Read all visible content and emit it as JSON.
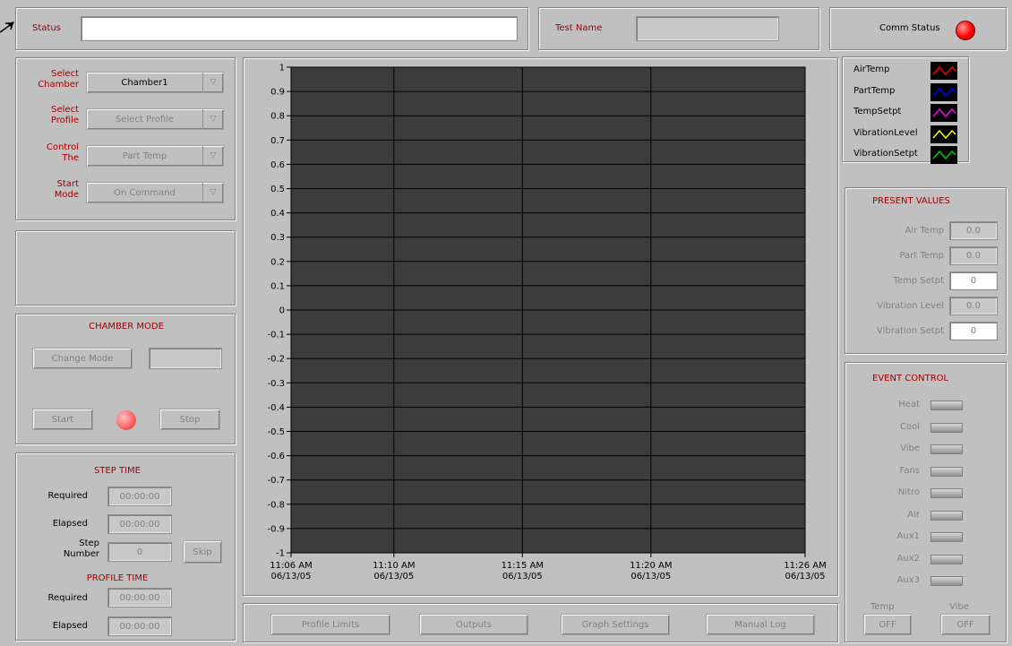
{
  "header": {
    "status_label": "Status",
    "status_value": "",
    "test_name_label": "Test Name",
    "test_name_value": "",
    "comm_status_label": "Comm Status",
    "comm_status_color": "#ff0000"
  },
  "selection": {
    "chamber_label_1": "Select",
    "chamber_label_2": "Chamber",
    "chamber_value": "Chamber1",
    "profile_label_1": "Select",
    "profile_label_2": "Profile",
    "profile_value": "Select Profile",
    "control_label_1": "Control",
    "control_label_2": "The",
    "control_value": "Part Temp",
    "start_label_1": "Start",
    "start_label_2": "Mode",
    "start_value": "On Command"
  },
  "chamber_mode": {
    "title": "CHAMBER MODE",
    "change_mode_label": "Change Mode",
    "mode_value": "",
    "start_label": "Start",
    "stop_label": "Stop",
    "indicator_color": "#ff6060"
  },
  "step_time": {
    "title": "STEP TIME",
    "required_label": "Required",
    "required_value": "00:00:00",
    "elapsed_label": "Elapsed",
    "elapsed_value": "00:00:00",
    "step_label_1": "Step",
    "step_label_2": "Number",
    "step_value": "0",
    "skip_label": "Skip"
  },
  "profile_time": {
    "title": "PROFILE TIME",
    "required_label": "Required",
    "required_value": "00:00:00",
    "elapsed_label": "Elapsed",
    "elapsed_value": "00:00:00"
  },
  "bottom_buttons": {
    "profile_limits": "Profile Limits",
    "outputs": "Outputs",
    "graph_settings": "Graph Settings",
    "manual_log": "Manual Log"
  },
  "legend": [
    {
      "name": "AirTemp",
      "color": "#ff0000"
    },
    {
      "name": "PartTemp",
      "color": "#0000ff"
    },
    {
      "name": "TempSetpt",
      "color": "#ff00ff"
    },
    {
      "name": "VibrationLevel",
      "color": "#ffff00"
    },
    {
      "name": "VibrationSetpt",
      "color": "#00cc00"
    }
  ],
  "present_values": {
    "title": "PRESENT VALUES",
    "air_temp_label": "Air Temp",
    "air_temp_value": "0.0",
    "part_temp_label": "Part Temp",
    "part_temp_value": "0.0",
    "temp_setpt_label": "Temp Setpt",
    "temp_setpt_value": "0",
    "vibration_level_label": "Vibration Level",
    "vibration_level_value": "0.0",
    "vibration_setpt_label": "Vibration Setpt",
    "vibration_setpt_value": "0"
  },
  "event_control": {
    "title": "EVENT CONTROL",
    "items": [
      "Heat",
      "Cool",
      "Vibe",
      "Fans",
      "Nitro",
      "Air",
      "Aux1",
      "Aux2",
      "Aux3"
    ],
    "temp_label": "Temp",
    "temp_value": "OFF",
    "vibe_label": "Vibe",
    "vibe_value": "OFF"
  },
  "chart_data": {
    "type": "line",
    "y_ticks": [
      "1",
      "0.9",
      "0.8",
      "0.7",
      "0.6",
      "0.5",
      "0.4",
      "0.3",
      "0.2",
      "0.1",
      "0",
      "-0.1",
      "-0.2",
      "-0.3",
      "-0.4",
      "-0.5",
      "-0.6",
      "-0.7",
      "-0.8",
      "-0.9",
      "-1"
    ],
    "ylim": [
      -1,
      1
    ],
    "x_ticks": [
      {
        "time": "11:06 AM",
        "date": "06/13/05",
        "minute": 6
      },
      {
        "time": "11:10 AM",
        "date": "06/13/05",
        "minute": 10
      },
      {
        "time": "11:15 AM",
        "date": "06/13/05",
        "minute": 15
      },
      {
        "time": "11:20 AM",
        "date": "06/13/05",
        "minute": 20
      },
      {
        "time": "11:26 AM",
        "date": "06/13/05",
        "minute": 26
      }
    ],
    "xlim_minutes": [
      6,
      26
    ],
    "series": [],
    "plot_bg": "#3c3c3c",
    "grid": true
  }
}
